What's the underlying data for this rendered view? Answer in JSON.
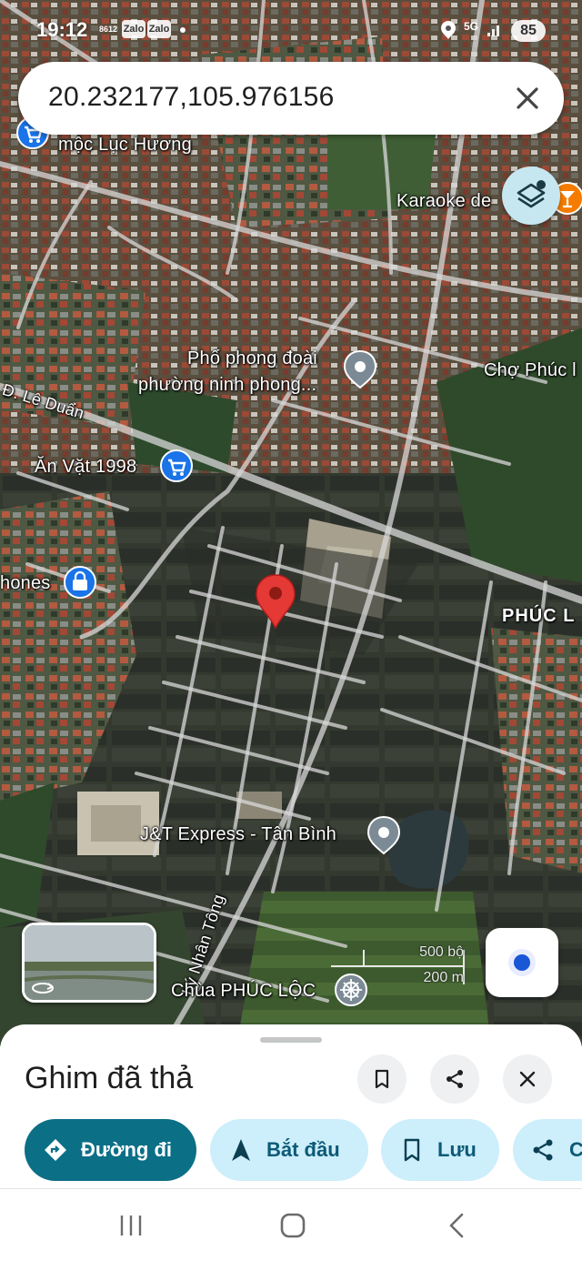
{
  "status_bar": {
    "time": "19:12",
    "notification_tags": [
      "8612",
      "Zalo",
      "Zalo"
    ],
    "network": "5G",
    "battery": "85"
  },
  "search": {
    "query": "20.232177,105.976156"
  },
  "map": {
    "labels": {
      "moc_luc_huong": "mộc Lục Hương",
      "karaoke": "Karaoke de",
      "pho_phong_doai_1": "Phố phong đoài",
      "pho_phong_doai_2": "phường ninh phong...",
      "cho_phuc": "Chợ Phúc l",
      "le_duan": "Đ. Lê Duẩn",
      "an_vat": "Ăn Vặt 1998",
      "phones": "hones",
      "phuc_l": "PHÚC L",
      "jt_express": "J&T Express - Tân Bình",
      "ly_nhan_tong": "Lý Nhân Tông",
      "chua_phuc_loc": "Chùa PHÚC LỘC"
    },
    "scale": {
      "imperial": "500 bộ",
      "metric": "200 m"
    },
    "accent_colors": {
      "pin": "#e53935",
      "poi_blue": "#1a73e8",
      "poi_gray": "#7b8a95",
      "karaoke_orange": "#f57c00"
    }
  },
  "bottom_sheet": {
    "title": "Ghim đã thả",
    "chips": {
      "directions": "Đường đi",
      "start": "Bắt đầu",
      "save": "Lưu",
      "share": "C"
    }
  }
}
